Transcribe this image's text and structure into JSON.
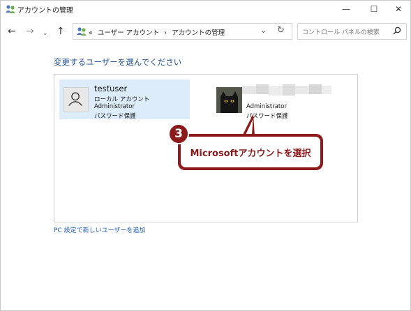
{
  "window": {
    "title": "アカウントの管理",
    "controls": {
      "minimize": "—",
      "maximize": "☐",
      "close": "✕"
    }
  },
  "nav": {
    "back": "←",
    "forward": "→",
    "recent": "⌄",
    "up": "↑",
    "address_prefix": "«",
    "breadcrumb": [
      "ユーザー アカウント",
      "アカウントの管理"
    ],
    "separator": "›",
    "dropdown": "⌄",
    "refresh": "↻",
    "search_placeholder": "コントロール パネルの検索"
  },
  "main": {
    "heading": "変更するユーザーを選んでください",
    "accounts": [
      {
        "name": "testuser",
        "lines": [
          "ローカル アカウント",
          "Administrator",
          "パスワード保護"
        ],
        "avatar": "person-icon",
        "selected": true
      },
      {
        "name": "",
        "name_redacted": true,
        "lines": [
          "Administrator",
          "パスワード保護"
        ],
        "avatar": "cat-photo",
        "selected": false
      }
    ],
    "add_user_link": "PC 設定で新しいユーザーを追加"
  },
  "annotation": {
    "step": "3",
    "text": "Microsoftアカウントを選択",
    "color": "#8c1a1a"
  },
  "colors": {
    "heading": "#1e4e8c",
    "link": "#1e5bb0",
    "selection": "#dcecfb"
  }
}
